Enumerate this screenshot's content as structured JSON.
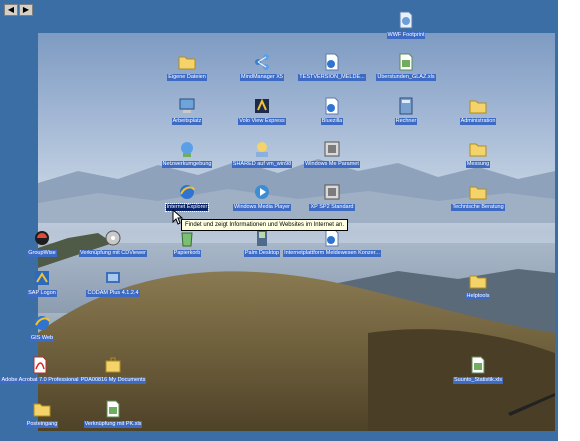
{
  "scroll": {
    "left": "◀",
    "right": "▶"
  },
  "icons": [
    {
      "label": "WWF Footprint",
      "icon": "file-icon"
    },
    {
      "label": "Eigene Dateien",
      "icon": "folder-icon"
    },
    {
      "label": "MindManager X5",
      "icon": "mindmanager-icon"
    },
    {
      "label": "TESTVERSION_MELDE...",
      "icon": "document-icon"
    },
    {
      "label": "Überstunden_GLAZ.xls",
      "icon": "excel-icon"
    },
    {
      "label": "Arbeitsplatz",
      "icon": "computer-icon"
    },
    {
      "label": "Volo View Express",
      "icon": "volo-view-icon"
    },
    {
      "label": "Bluezilla",
      "icon": "document-icon"
    },
    {
      "label": "Rechner",
      "icon": "calculator-icon"
    },
    {
      "label": "Administration",
      "icon": "folder-icon"
    },
    {
      "label": "Netzwerkumgebung",
      "icon": "network-icon"
    },
    {
      "label": "SHARED auf vm_win98",
      "icon": "network-drive-icon"
    },
    {
      "label": "Windows Me Paramet",
      "icon": "settings-icon"
    },
    {
      "label": "Messung",
      "icon": "folder-icon"
    },
    {
      "label": "Internet Explorer",
      "icon": "internet-explorer-icon"
    },
    {
      "label": "Windows Media Player",
      "icon": "media-player-icon"
    },
    {
      "label": "XP SP2 Standard",
      "icon": "settings-icon"
    },
    {
      "label": "Technische Beratung",
      "icon": "folder-icon"
    },
    {
      "label": "GroupWise",
      "icon": "groupwise-icon"
    },
    {
      "label": "Verknüpfung mit CDViewer",
      "icon": "cdviewer-icon"
    },
    {
      "label": "Papierkorb",
      "icon": "recycle-bin-icon"
    },
    {
      "label": "Palm Desktop",
      "icon": "palm-icon"
    },
    {
      "label": "Internetplattform Meldewesen Konzer...",
      "icon": "document-icon"
    },
    {
      "label": "SAP Logon",
      "icon": "sap-icon"
    },
    {
      "label": "CODAM Plus 4.1.2.4",
      "icon": "codam-icon"
    },
    {
      "label": "Helptools",
      "icon": "folder-icon"
    },
    {
      "label": "GIS Web",
      "icon": "internet-explorer-icon"
    },
    {
      "label": "Adobe Acrobat 7.0 Professional",
      "icon": "acrobat-icon"
    },
    {
      "label": "PDA00816 My Documents",
      "icon": "briefcase-icon"
    },
    {
      "label": "Suunto_Statistik.xls",
      "icon": "excel-icon"
    },
    {
      "label": "Posteingang",
      "icon": "folder-icon"
    },
    {
      "label": "Verknüpfung mit PK.xls",
      "icon": "excel-icon"
    }
  ],
  "tooltip": {
    "text": "Findet und zeigt Informationen und Websites im Internet an."
  }
}
